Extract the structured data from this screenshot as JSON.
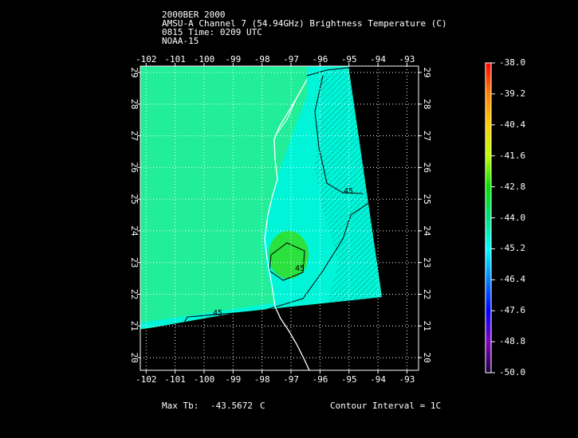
{
  "header": {
    "line1": "2000BER 2000",
    "line2": "AMSU-A Channel 7 (54.94GHz) Brightness Temperature (C)",
    "line3": "0815 Time: 0209 UTC",
    "line4": "NOAA-15"
  },
  "map": {
    "lon_labels": [
      "-102",
      "-101",
      "-100",
      "-99",
      "-98",
      "-97",
      "-96",
      "-95",
      "-94",
      "-93"
    ],
    "lat_labels": [
      "20",
      "21",
      "22",
      "23",
      "24",
      "25",
      "26",
      "27",
      "28",
      "29"
    ],
    "lon_range": [
      -102.2,
      -92.6
    ],
    "lat_range": [
      19.6,
      29.2
    ],
    "contour_labels": [
      "45",
      "45",
      "45"
    ]
  },
  "colorbar": {
    "labels": [
      "-38.0",
      "-39.2",
      "-40.4",
      "-41.6",
      "-42.8",
      "-44.0",
      "-45.2",
      "-46.4",
      "-47.6",
      "-48.8",
      "-50.0"
    ],
    "colors": [
      "#ff0000",
      "#ff8000",
      "#ffcc00",
      "#bfff00",
      "#00e000",
      "#00e080",
      "#00ffff",
      "#0080ff",
      "#0000ff",
      "#8000c0",
      "#200040"
    ]
  },
  "footer": {
    "max_label": "Max Tb:",
    "max_value": "-43.5672",
    "max_unit": "C",
    "contour_interval": "Contour Interval = 1C"
  }
}
